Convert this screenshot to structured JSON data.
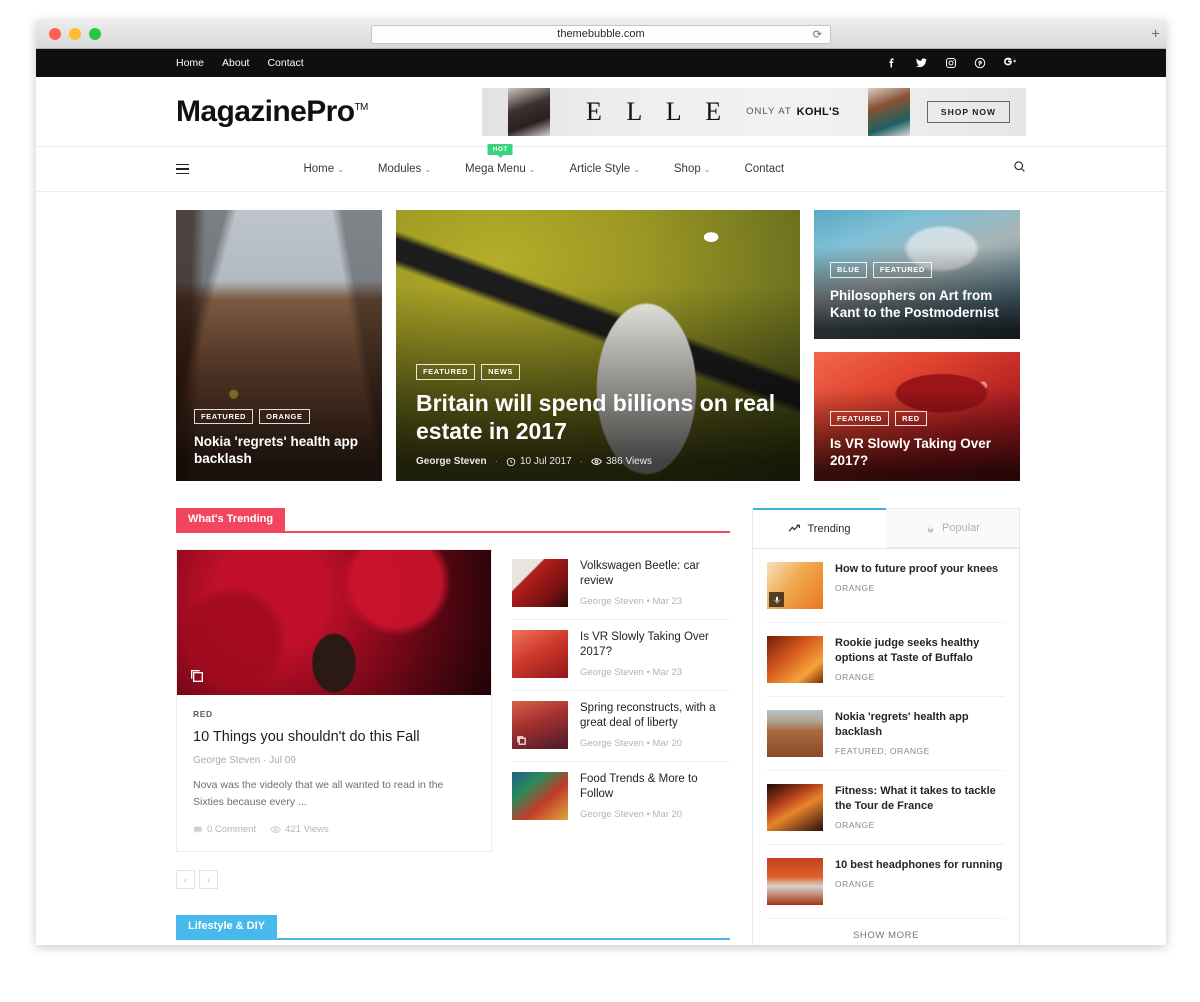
{
  "browser": {
    "url": "themebubble.com",
    "reload_icon": "reload-icon",
    "new_tab_icon": "plus-icon"
  },
  "topbar": {
    "links": [
      {
        "label": "Home"
      },
      {
        "label": "About"
      },
      {
        "label": "Contact"
      }
    ],
    "socials": [
      {
        "name": "facebook-icon"
      },
      {
        "name": "twitter-icon"
      },
      {
        "name": "instagram-icon"
      },
      {
        "name": "pinterest-icon"
      },
      {
        "name": "googleplus-icon"
      }
    ]
  },
  "header": {
    "logo_text": "MagazinePro",
    "logo_tm": "TM",
    "ad": {
      "brand": "E L L E",
      "only_at": "ONLY AT",
      "retailer": "KOHL'S",
      "cta": "SHOP NOW"
    }
  },
  "mainnav": {
    "menu_icon": "hamburger-icon",
    "search_icon": "search-icon",
    "items": [
      {
        "label": "Home",
        "caret": true,
        "badge": ""
      },
      {
        "label": "Modules",
        "caret": true,
        "badge": ""
      },
      {
        "label": "Mega Menu",
        "caret": true,
        "badge": "HOT"
      },
      {
        "label": "Article Style",
        "caret": true,
        "badge": ""
      },
      {
        "label": "Shop",
        "caret": true,
        "badge": ""
      },
      {
        "label": "Contact",
        "caret": false,
        "badge": ""
      }
    ]
  },
  "hero": {
    "left": {
      "tags": [
        "FEATURED",
        "ORANGE"
      ],
      "title": "Nokia 'regrets' health app backlash"
    },
    "center": {
      "tags": [
        "FEATURED",
        "NEWS"
      ],
      "title": "Britain will spend billions on real estate in 2017",
      "author": "George Steven",
      "date": "10 Jul 2017",
      "views": "386 Views"
    },
    "right_top": {
      "tags": [
        "BLUE",
        "FEATURED"
      ],
      "title": "Philosophers on Art from Kant to the Postmodernist"
    },
    "right_bottom": {
      "tags": [
        "FEATURED",
        "RED"
      ],
      "title": "Is VR Slowly Taking Over 2017?"
    }
  },
  "trending_section": {
    "heading": "What's Trending",
    "accent_color": "#f4455f",
    "featured": {
      "category": "RED",
      "title": "10 Things you shouldn't do this Fall",
      "author": "George Steven",
      "date": "Jul 09",
      "excerpt": "Nova was the videoly that we all wanted to read in the Sixties because every ...",
      "comments": "0 Comment",
      "views": "421 Views",
      "gallery_icon": "gallery-icon"
    },
    "items": [
      {
        "title": "Volkswagen Beetle: car review",
        "author": "George Steven",
        "date": "Mar 23",
        "thumb": "th-car",
        "badge": ""
      },
      {
        "title": "Is VR Slowly Taking Over 2017?",
        "author": "George Steven",
        "date": "Mar 23",
        "thumb": "th-vr",
        "badge": ""
      },
      {
        "title": "Spring reconstructs, with a great deal of liberty",
        "author": "George Steven",
        "date": "Mar 20",
        "thumb": "th-spring",
        "badge": "gallery-icon"
      },
      {
        "title": "Food Trends & More to Follow",
        "author": "George Steven",
        "date": "Mar 20",
        "thumb": "th-food",
        "badge": ""
      }
    ],
    "pagination": {
      "prev": "‹",
      "next": "›"
    }
  },
  "sidebar": {
    "tabs": [
      {
        "label": "Trending",
        "icon": "trending-up-icon",
        "active": true
      },
      {
        "label": "Popular",
        "icon": "fire-icon",
        "active": false
      }
    ],
    "items": [
      {
        "title": "How to future proof your knees",
        "category": "ORANGE",
        "thumb": "th-knees",
        "badge": "audio-icon"
      },
      {
        "title": "Rookie judge seeks healthy options at Taste of Buffalo",
        "category": "ORANGE",
        "thumb": "th-rookie",
        "badge": ""
      },
      {
        "title": "Nokia 'regrets' health app backlash",
        "category": "FEATURED, ORANGE",
        "thumb": "th-nokia",
        "badge": ""
      },
      {
        "title": "Fitness: What it takes to tackle the Tour de France",
        "category": "ORANGE",
        "thumb": "th-fitness",
        "badge": ""
      },
      {
        "title": "10 best headphones for running",
        "category": "ORANGE",
        "thumb": "th-headphones",
        "badge": ""
      }
    ],
    "show_more": "SHOW MORE"
  },
  "lifestyle_section": {
    "heading": "Lifestyle & DIY",
    "accent_color": "#48b9ec"
  }
}
